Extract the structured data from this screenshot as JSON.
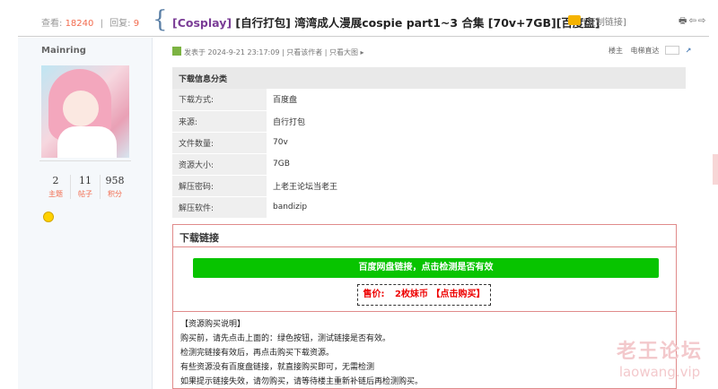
{
  "header": {
    "views_label": "查看:",
    "views": "18240",
    "replies_label": "回复:",
    "replies": "9",
    "title_category": "[Cosplay]",
    "title_rest": " [自行打包] 湾湾成人漫展cospie part1~3 合集 [70v+7GB][百度盘]",
    "copy_link": "[复制链接]",
    "tools": "🖶⇦⇨"
  },
  "sidebar": {
    "author": "Mainring",
    "stats": [
      {
        "value": "2",
        "label": "主题"
      },
      {
        "value": "11",
        "label": "帖子"
      },
      {
        "value": "958",
        "label": "积分"
      }
    ]
  },
  "post": {
    "meta": "发表于 2024-9-21 23:17:09  |  只看该作者  |  只看大图 ▸",
    "floor_label": "楼主",
    "floor_jump": "电梯直达",
    "floor_go": "↗"
  },
  "info_table": {
    "header": "下载信息分类",
    "rows": [
      {
        "k": "下载方式:",
        "v": "百度盘"
      },
      {
        "k": "来源:",
        "v": "自行打包"
      },
      {
        "k": "文件数量:",
        "v": "70v"
      },
      {
        "k": "资源大小:",
        "v": "7GB"
      },
      {
        "k": "解压密码:",
        "v": "上老王论坛当老王"
      },
      {
        "k": "解压软件:",
        "v": "bandizip"
      }
    ]
  },
  "download": {
    "title": "下载链接",
    "check_button": "百度网盘链接，点击检测是否有效",
    "price_label": "售价:",
    "price_value": "2枚妹币",
    "buy_label": "【点击购买】",
    "notes": [
      "【资源购买说明】",
      "购买前，请先点击上面的：绿色按钮，测试链接是否有效。",
      "检测完链接有效后，再点击购买下载资源。",
      "有些资源没有百度盘链接，就直接购买即可，无需检测",
      "如果提示链接失效，请勿购买，请等待楼主重新补链后再检测购买。"
    ]
  },
  "watermark": {
    "cn": "老王论坛",
    "en": "laowang.vip"
  },
  "colors": {
    "accent_red": "#f26c4f",
    "title_purple": "#7a3c96",
    "button_green": "#08c400",
    "price_red": "#e00000"
  }
}
